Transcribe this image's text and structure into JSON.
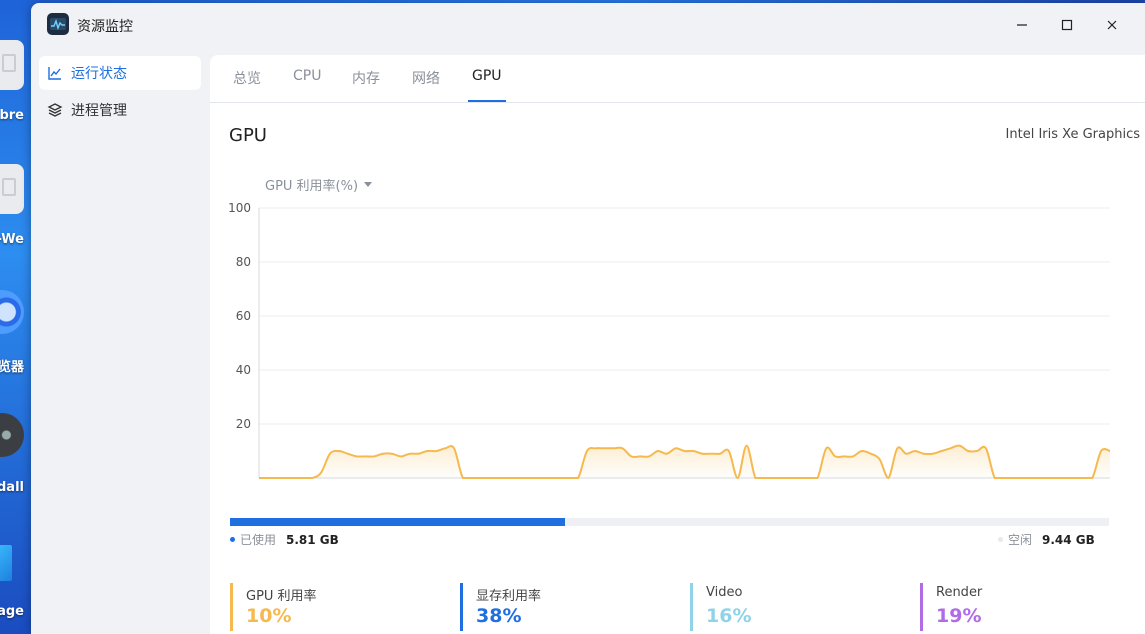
{
  "desktop": {
    "labels": [
      "ibre",
      "e-We",
      "览器",
      "ndall",
      "epage"
    ]
  },
  "window": {
    "title": "资源监控",
    "controls": [
      "minimize-icon",
      "maximize-icon",
      "close-icon"
    ]
  },
  "sidebar": {
    "items": [
      {
        "label": "运行状态",
        "icon": "line-chart-icon",
        "active": true
      },
      {
        "label": "进程管理",
        "icon": "layers-icon",
        "active": false
      }
    ]
  },
  "tabs": [
    {
      "label": "总览"
    },
    {
      "label": "CPU"
    },
    {
      "label": "内存"
    },
    {
      "label": "网络"
    },
    {
      "label": "GPU",
      "active": true
    }
  ],
  "gpu": {
    "heading": "GPU",
    "model": "Intel Iris Xe Graphics",
    "metric_select": "GPU 利用率(%)"
  },
  "memory": {
    "used_label": "已使用",
    "used_value": "5.81 GB",
    "free_label": "空闲",
    "free_value": "9.44 GB",
    "used_fraction": 0.381,
    "used_color": "#1f6fe0",
    "free_color": "#eef0f3"
  },
  "stats": [
    {
      "label": "GPU 利用率",
      "value": "10%",
      "color": "#f5b94f"
    },
    {
      "label": "显存利用率",
      "value": "38%",
      "color": "#1f6fe0"
    },
    {
      "label": "Video",
      "value": "16%",
      "color": "#8fd3e8"
    },
    {
      "label": "Render",
      "value": "19%",
      "color": "#b06be6"
    }
  ],
  "chart_data": {
    "type": "area",
    "ylim": [
      0,
      100
    ],
    "yticks": [
      20,
      40,
      60,
      80,
      100
    ],
    "grid": true,
    "color": "#f5b94f",
    "series": [
      {
        "values": [
          0,
          0,
          0,
          0,
          0,
          0,
          0,
          2,
          9,
          10,
          9,
          8,
          8,
          8,
          9,
          9,
          8,
          9,
          9,
          10,
          10,
          11,
          11,
          0,
          0,
          0,
          0,
          0,
          0,
          0,
          0,
          0,
          0,
          0,
          0,
          0,
          0,
          10,
          11,
          11,
          11,
          11,
          8,
          8,
          8,
          10,
          9,
          11,
          10,
          10,
          9,
          9,
          9,
          10,
          0,
          12,
          0,
          0,
          0,
          0,
          0,
          0,
          0,
          0,
          11,
          8,
          8,
          8,
          10,
          9,
          7,
          0,
          11,
          9,
          10,
          9,
          9,
          10,
          11,
          12,
          10,
          10,
          11,
          0,
          0,
          0,
          0,
          0,
          0,
          0,
          0,
          0,
          0,
          0,
          0,
          10,
          10
        ]
      }
    ]
  }
}
